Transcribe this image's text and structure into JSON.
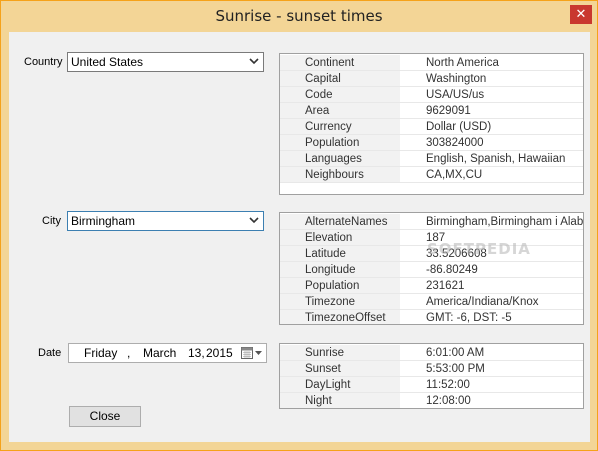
{
  "window": {
    "title": "Sunrise - sunset times",
    "close_glyph": "✕"
  },
  "country": {
    "label": "Country",
    "value": "United States"
  },
  "city": {
    "label": "City",
    "value": "Birmingham"
  },
  "date": {
    "label": "Date",
    "weekday": "Friday",
    "sep": ",",
    "month": "March",
    "day": "13,",
    "year": "2015",
    "icon": "calendar-icon"
  },
  "country_info": [
    {
      "key": "Continent",
      "value": "North America"
    },
    {
      "key": "Capital",
      "value": "Washington"
    },
    {
      "key": "Code",
      "value": "USA/US/us"
    },
    {
      "key": "Area",
      "value": "9629091"
    },
    {
      "key": "Currency",
      "value": "Dollar (USD)"
    },
    {
      "key": "Population",
      "value": "303824000"
    },
    {
      "key": "Languages",
      "value": "English, Spanish, Hawaiian"
    },
    {
      "key": "Neighbours",
      "value": "CA,MX,CU"
    }
  ],
  "city_info": [
    {
      "key": "AlternateNames",
      "value": "Birmingham,Birmingham i Alabama"
    },
    {
      "key": "Elevation",
      "value": "187"
    },
    {
      "key": "Latitude",
      "value": "33.5206608"
    },
    {
      "key": "Longitude",
      "value": "-86.80249"
    },
    {
      "key": "Population",
      "value": "231621"
    },
    {
      "key": "Timezone",
      "value": "America/Indiana/Knox"
    },
    {
      "key": "TimezoneOffset",
      "value": "GMT: -6, DST: -5"
    }
  ],
  "sun_info": [
    {
      "key": "Sunrise",
      "value": "6:01:00 AM"
    },
    {
      "key": "Sunset",
      "value": "5:53:00 PM"
    },
    {
      "key": "DayLight",
      "value": "11:52:00"
    },
    {
      "key": "Night",
      "value": "12:08:00"
    }
  ],
  "buttons": {
    "close": "Close"
  },
  "watermark": "SOFTPEDIA",
  "colors": {
    "titlebar": "#f3d596",
    "border": "#f5a21a",
    "close_button": "#c9382f"
  }
}
